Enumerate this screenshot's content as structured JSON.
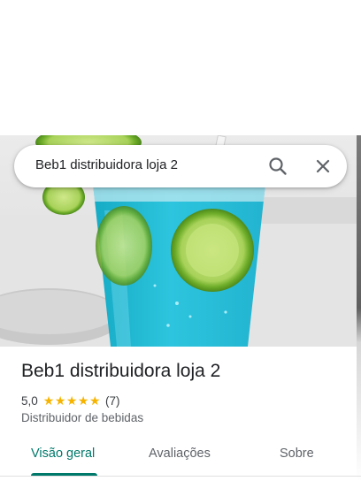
{
  "search": {
    "query": "Beb1 distribuidora loja 2",
    "search_icon": "search-icon",
    "close_icon": "close-icon"
  },
  "hero": {
    "photo": "blue-drink-with-lime-slices"
  },
  "place": {
    "title": "Beb1 distribuidora loja 2",
    "rating": "5,0",
    "stars": "★★★★★",
    "reviews_count": "(7)",
    "category": "Distribuidor de bebidas"
  },
  "tabs": [
    {
      "label": "Visão geral",
      "active": true
    },
    {
      "label": "Avaliações",
      "active": false
    },
    {
      "label": "Sobre",
      "active": false
    }
  ],
  "colors": {
    "accent": "#00796b",
    "star": "#f6b400",
    "text": "#202124",
    "secondary_text": "#5f6368"
  }
}
